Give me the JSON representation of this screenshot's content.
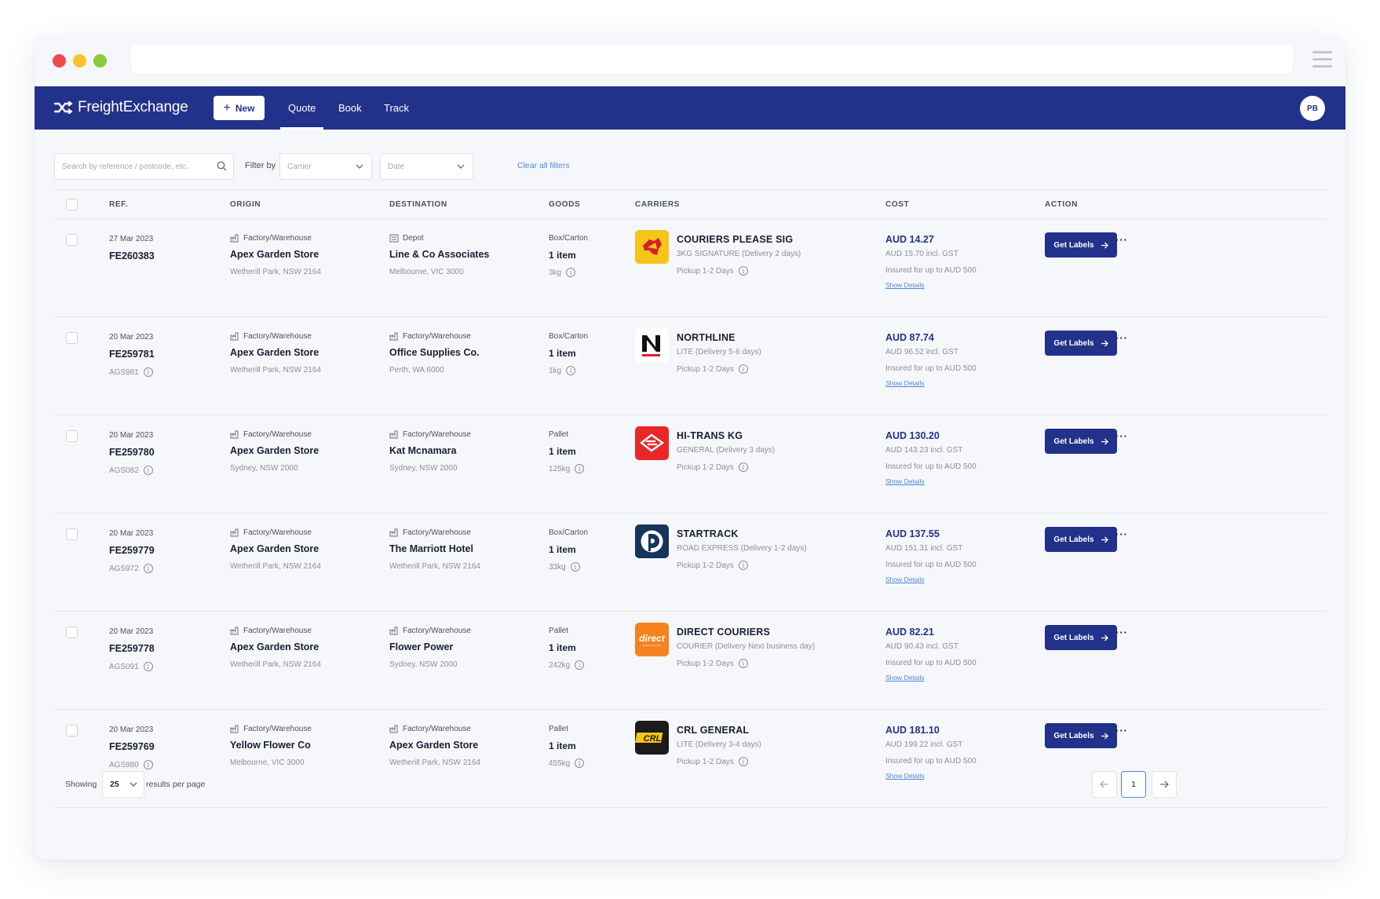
{
  "app": {
    "name": "FreightExchange",
    "new_label": "New",
    "tabs": [
      {
        "label": "Quote",
        "active": true
      },
      {
        "label": "Book",
        "active": false
      },
      {
        "label": "Track",
        "active": false
      }
    ],
    "user_initials": "PB"
  },
  "filters": {
    "search_placeholder": "Search by reference / postcode, etc.",
    "filter_by_label": "Filter by",
    "carrier_placeholder": "Carrier",
    "date_placeholder": "Date",
    "clear_label": "Clear all filters"
  },
  "table": {
    "headers": {
      "ref": "REF.",
      "origin": "ORIGIN",
      "destination": "DESTINATION",
      "goods": "GOODS",
      "carriers": "CARRIERS",
      "cost": "COST",
      "action": "ACTION"
    },
    "action_label": "Get Labels",
    "more_label": "···",
    "pickup_label": "Pickup 1-2 Days",
    "insured_label": "Insured for up to AUD 500",
    "details_label": "Show Details",
    "rows": [
      {
        "date": "27 Mar 2023",
        "ref": "FE260383",
        "sub_ref": "",
        "origin": {
          "type": "Factory/Warehouse",
          "name": "Apex Garden Store",
          "address": "Wetherill Park, NSW 2164"
        },
        "destination": {
          "type": "Depot",
          "name": "Line & Co Associates",
          "address": "Melbourne, VIC 3000"
        },
        "goods": {
          "type": "Box/Carton",
          "qty": "1 item",
          "weight": "3kg"
        },
        "carrier": {
          "name": "COURIERS PLEASE SIG",
          "service": "3KG SIGNATURE (Delivery 2 days)",
          "logo": "couriers-please",
          "color": "#f5c518"
        },
        "cost": {
          "total": "AUD 14.27",
          "gst": "AUD 15.70 incl. GST"
        }
      },
      {
        "date": "20 Mar 2023",
        "ref": "FE259781",
        "sub_ref": "AGS981",
        "origin": {
          "type": "Factory/Warehouse",
          "name": "Apex Garden Store",
          "address": "Wetherill Park, NSW 2164"
        },
        "destination": {
          "type": "Factory/Warehouse",
          "name": "Office Supplies Co.",
          "address": "Perth, WA 6000"
        },
        "goods": {
          "type": "Box/Carton",
          "qty": "1 item",
          "weight": "1kg"
        },
        "carrier": {
          "name": "NORTHLINE",
          "service": "LITE (Delivery 5-6 days)",
          "logo": "northline",
          "color": "#ffffff"
        },
        "cost": {
          "total": "AUD 87.74",
          "gst": "AUD 96.52 incl. GST"
        }
      },
      {
        "date": "20 Mar 2023",
        "ref": "FE259780",
        "sub_ref": "AGS082",
        "origin": {
          "type": "Factory/Warehouse",
          "name": "Apex Garden Store",
          "address": "Sydney, NSW 2000"
        },
        "destination": {
          "type": "Factory/Warehouse",
          "name": "Kat Mcnamara",
          "address": "Sydney, NSW 2000"
        },
        "goods": {
          "type": "Pallet",
          "qty": "1 item",
          "weight": "125kg"
        },
        "carrier": {
          "name": "HI-TRANS KG",
          "service": "GENERAL (Delivery 3 days)",
          "logo": "hi-trans",
          "color": "#e8272a"
        },
        "cost": {
          "total": "AUD 130.20",
          "gst": "AUD 143.23 incl. GST"
        }
      },
      {
        "date": "20 Mar 2023",
        "ref": "FE259779",
        "sub_ref": "AGS972",
        "origin": {
          "type": "Factory/Warehouse",
          "name": "Apex Garden Store",
          "address": "Wetherill Park, NSW 2164"
        },
        "destination": {
          "type": "Factory/Warehouse",
          "name": "The Marriott Hotel",
          "address": "Wetherill Park, NSW 2164"
        },
        "goods": {
          "type": "Box/Carton",
          "qty": "1 item",
          "weight": "33kg"
        },
        "carrier": {
          "name": "STARTRACK",
          "service": "ROAD EXPRESS (Delivery 1-2 days)",
          "logo": "startrack",
          "color": "#16345c"
        },
        "cost": {
          "total": "AUD 137.55",
          "gst": "AUD 151.31 incl. GST"
        }
      },
      {
        "date": "20 Mar 2023",
        "ref": "FE259778",
        "sub_ref": "AGS091",
        "origin": {
          "type": "Factory/Warehouse",
          "name": "Apex Garden Store",
          "address": "Wetherill Park, NSW 2164"
        },
        "destination": {
          "type": "Factory/Warehouse",
          "name": "Flower Power",
          "address": "Sydney, NSW 2000"
        },
        "goods": {
          "type": "Pallet",
          "qty": "1 item",
          "weight": "242kg"
        },
        "carrier": {
          "name": "DIRECT COURIERS",
          "service": "COURIER (Delivery Next business day)",
          "logo": "direct",
          "color": "#f5821f",
          "logo_text": "direct"
        },
        "cost": {
          "total": "AUD 82.21",
          "gst": "AUD 90.43 incl. GST"
        }
      },
      {
        "date": "20 Mar 2023",
        "ref": "FE259769",
        "sub_ref": "AGS980",
        "origin": {
          "type": "Factory/Warehouse",
          "name": "Yellow Flower Co",
          "address": "Melbourne, VIC 3000"
        },
        "destination": {
          "type": "Factory/Warehouse",
          "name": "Apex Garden Store",
          "address": "Wetherill Park, NSW 2164"
        },
        "goods": {
          "type": "Pallet",
          "qty": "1 item",
          "weight": "455kg"
        },
        "carrier": {
          "name": "CRL GENERAL",
          "service": "LITE (Delivery 3-4 days)",
          "logo": "crl",
          "color": "#1b1b1b",
          "logo_text": "CRL"
        },
        "cost": {
          "total": "AUD 181.10",
          "gst": "AUD 199.22 incl. GST"
        }
      }
    ]
  },
  "footer": {
    "showing_label": "Showing",
    "per_page": "25",
    "results_label": "results per page",
    "current_page": "1"
  }
}
